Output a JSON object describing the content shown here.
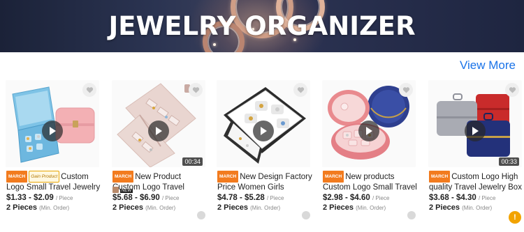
{
  "banner": {
    "title": "JEWELRY ORGANIZER"
  },
  "section": {
    "view_more": "View More"
  },
  "icons": {
    "favorite": "heart-icon",
    "play": "play-icon",
    "help": "help-icon"
  },
  "colors": {
    "link": "#1a73e8",
    "badge": "#f27b1e",
    "help": "#f2a300"
  },
  "products": [
    {
      "badges": [
        "MARCH",
        "Gain Product"
      ],
      "title": "Custom Logo Small Travel Jewelry Box Lady...",
      "price": "$1.33 - $2.09",
      "price_unit": "/ Piece",
      "moq": "2 Pieces",
      "moq_unit": "(Min. Order)",
      "duration": ""
    },
    {
      "badges": [
        "MARCH"
      ],
      "title": "New Product Custom Logo Travel Jewelry Bag...",
      "new_tag": "NEW",
      "price": "$5.68 - $6.90",
      "price_unit": "/ Piece",
      "moq": "2 Pieces",
      "moq_unit": "(Min. Order)",
      "duration": "00:34"
    },
    {
      "badges": [
        "MARCH"
      ],
      "title": "New Design Factory Price Women Girls Organizer...",
      "price": "$4.78 - $5.28",
      "price_unit": "/ Piece",
      "moq": "2 Pieces",
      "moq_unit": "(Min. Order)",
      "duration": ""
    },
    {
      "badges": [
        "MARCH"
      ],
      "title": "New products Custom Logo Small Travel Jewelry Bo...",
      "price": "$2.98 - $4.60",
      "price_unit": "/ Piece",
      "moq": "2 Pieces",
      "moq_unit": "(Min. Order)",
      "duration": ""
    },
    {
      "badges": [
        "MARCH"
      ],
      "title": "Custom Logo High quality Travel Jewelry Box Wit...",
      "price": "$3.68 - $4.30",
      "price_unit": "/ Piece",
      "moq": "2 Pieces",
      "moq_unit": "(Min. Order)",
      "duration": "00:33"
    }
  ]
}
